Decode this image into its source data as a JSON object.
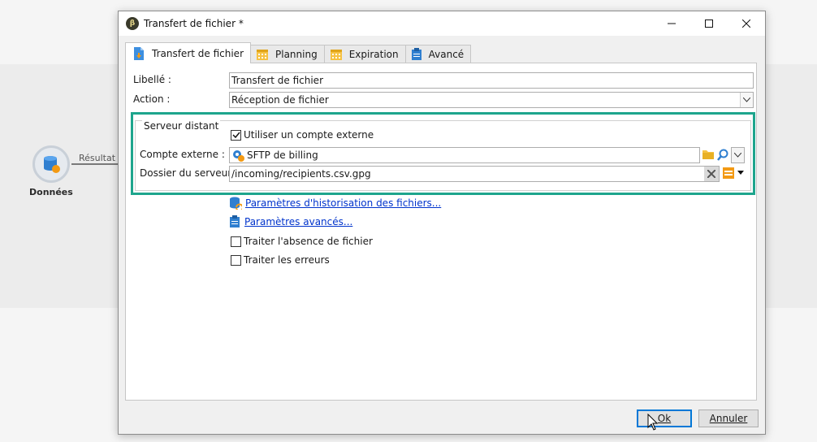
{
  "background": {
    "node_label": "Données",
    "link_label": "Résultat"
  },
  "dialog": {
    "title": "Transfert de fichier *",
    "tabs": [
      {
        "label": "Transfert de fichier",
        "icon": "file-transfer-icon",
        "active": true
      },
      {
        "label": "Planning",
        "icon": "calendar-icon",
        "active": false
      },
      {
        "label": "Expiration",
        "icon": "calendar-icon",
        "active": false
      },
      {
        "label": "Avancé",
        "icon": "clipboard-icon",
        "active": false
      }
    ],
    "form": {
      "libelle_label": "Libellé :",
      "libelle_value": "Transfert de fichier",
      "action_label": "Action :",
      "action_value": "Réception de fichier"
    },
    "server_group": {
      "title": "Serveur distant",
      "use_external_label": "Utiliser un compte externe",
      "use_external_checked": true,
      "account_label": "Compte externe :",
      "account_value": "SFTP de billing",
      "folder_label": "Dossier du serveur :",
      "folder_value": "/incoming/recipients.csv.gpg"
    },
    "links": {
      "history": "Paramètres d'historisation des fichiers...",
      "advanced": "Paramètres avancés..."
    },
    "options": {
      "missing_file_label": "Traiter l'absence de fichier",
      "missing_file_checked": false,
      "errors_label": "Traiter les erreurs",
      "errors_checked": false
    },
    "buttons": {
      "ok": "Ok",
      "cancel": "Annuler"
    }
  },
  "colors": {
    "highlight": "#1ea58d",
    "link": "#0033cc",
    "default_button": "#0078d7"
  }
}
